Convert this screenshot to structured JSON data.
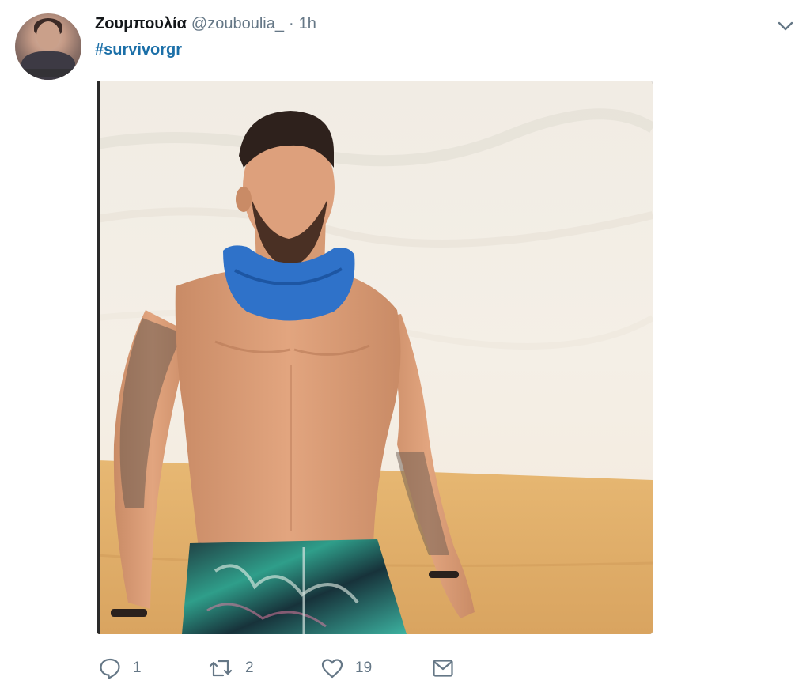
{
  "tweet": {
    "display_name": "Ζουμπουλία",
    "handle": "@zouboulia_",
    "separator": "·",
    "time": "1h",
    "hashtag": "#survivorgr",
    "media_description": "",
    "actions": {
      "reply_count": "1",
      "retweet_count": "2",
      "like_count": "19"
    }
  },
  "icons": {
    "menu": "chevron-down-icon",
    "reply": "reply-icon",
    "retweet": "retweet-icon",
    "like": "heart-icon",
    "message": "envelope-icon"
  },
  "colors": {
    "hashtag": "#1b6fa8",
    "secondary_text": "#657786",
    "primary_text": "#14171a"
  }
}
